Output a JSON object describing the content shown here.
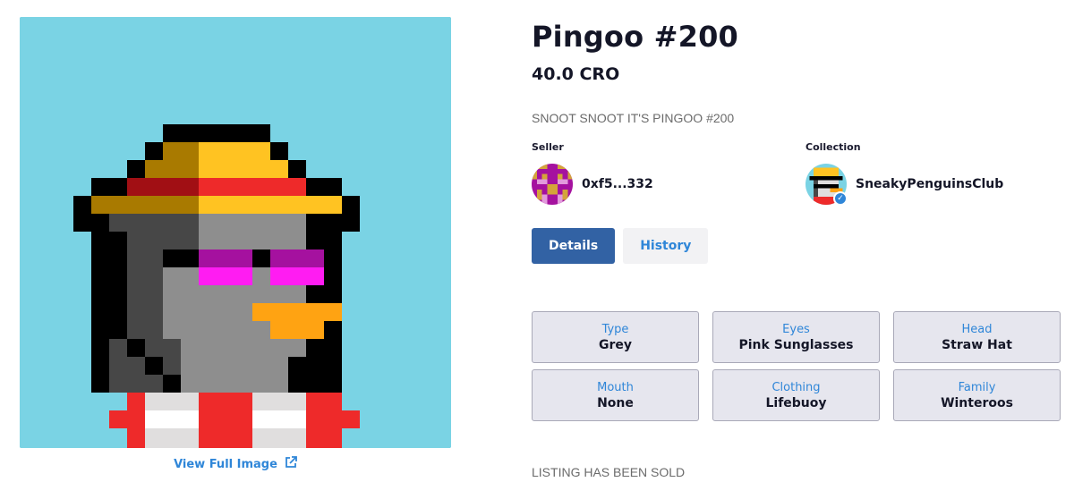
{
  "nft": {
    "title": "Pingoo #200",
    "price": "40.0 CRO",
    "description": "SNOOT SNOOT IT'S PINGOO #200",
    "view_full_image": "View Full Image"
  },
  "seller": {
    "label": "Seller",
    "address": "0xf5...332"
  },
  "collection": {
    "label": "Collection",
    "name": "SneakyPenguinsClub",
    "verified_icon": "check-icon"
  },
  "tabs": {
    "details": "Details",
    "history": "History",
    "active": "Details"
  },
  "traits": [
    {
      "type": "Type",
      "value": "Grey"
    },
    {
      "type": "Eyes",
      "value": "Pink Sunglasses"
    },
    {
      "type": "Head",
      "value": "Straw Hat"
    },
    {
      "type": "Mouth",
      "value": "None"
    },
    {
      "type": "Clothing",
      "value": "Lifebuoy"
    },
    {
      "type": "Family",
      "value": "Winteroos"
    }
  ],
  "status": "LISTING HAS BEEN SOLD",
  "colors": {
    "art_background": "#7ad3e4",
    "accent_blue": "#2f86d8",
    "active_tab": "#3262a4",
    "trait_bg": "#e6e6ee"
  }
}
